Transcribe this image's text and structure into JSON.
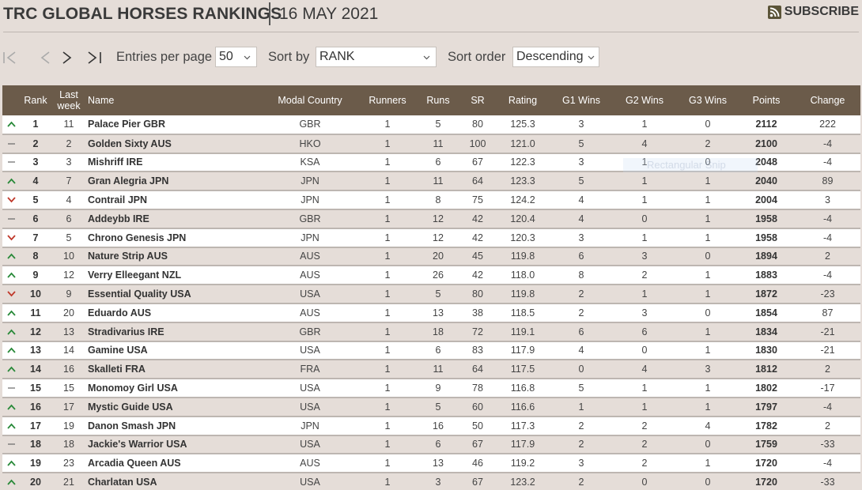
{
  "header": {
    "title": "TRC GLOBAL HORSES RANKINGS",
    "date": "16 MAY 2021",
    "subscribe_label": "SUBSCRIBE",
    "subscribe_icon": "rss-icon"
  },
  "controls": {
    "first_page_icon": "first-page-icon",
    "prev_page_icon": "prev-page-icon",
    "next_page_icon": "next-page-icon",
    "last_page_icon": "last-page-icon",
    "entries_label": "Entries per page",
    "entries_value": "50",
    "sort_by_label": "Sort by",
    "sort_by_value": "RANK",
    "sort_order_label": "Sort order",
    "sort_order_value": "Descending"
  },
  "overlay": {
    "tooltip": "Rectangular Snip"
  },
  "colors": {
    "header_bg": "#6b5b4a",
    "page_bg": "#e5ddd8",
    "up": "#2a8a3a",
    "down": "#c0392b"
  },
  "table": {
    "columns": [
      "",
      "Rank",
      "Last week",
      "Name",
      "Modal Country",
      "Runners",
      "Runs",
      "SR",
      "Rating",
      "G1 Wins",
      "G2 Wins",
      "G3 Wins",
      "Points",
      "Change"
    ],
    "rows": [
      {
        "trend": "up",
        "rank": "1",
        "last": "11",
        "name": "Palace Pier GBR",
        "country": "GBR",
        "runners": "1",
        "runs": "5",
        "sr": "80",
        "rating": "125.3",
        "g1": "3",
        "g2": "1",
        "g3": "0",
        "points": "2112",
        "change": "222"
      },
      {
        "trend": "same",
        "rank": "2",
        "last": "2",
        "name": "Golden Sixty AUS",
        "country": "HKO",
        "runners": "1",
        "runs": "11",
        "sr": "100",
        "rating": "121.0",
        "g1": "5",
        "g2": "4",
        "g3": "2",
        "points": "2100",
        "change": "-4"
      },
      {
        "trend": "same",
        "rank": "3",
        "last": "3",
        "name": "Mishriff IRE",
        "country": "KSA",
        "runners": "1",
        "runs": "6",
        "sr": "67",
        "rating": "122.3",
        "g1": "3",
        "g2": "1",
        "g3": "0",
        "points": "2048",
        "change": "-4"
      },
      {
        "trend": "up",
        "rank": "4",
        "last": "7",
        "name": "Gran Alegria JPN",
        "country": "JPN",
        "runners": "1",
        "runs": "11",
        "sr": "64",
        "rating": "123.3",
        "g1": "5",
        "g2": "1",
        "g3": "1",
        "points": "2040",
        "change": "89"
      },
      {
        "trend": "down",
        "rank": "5",
        "last": "4",
        "name": "Contrail JPN",
        "country": "JPN",
        "runners": "1",
        "runs": "8",
        "sr": "75",
        "rating": "124.2",
        "g1": "4",
        "g2": "1",
        "g3": "1",
        "points": "2004",
        "change": "3"
      },
      {
        "trend": "same",
        "rank": "6",
        "last": "6",
        "name": "Addeybb IRE",
        "country": "GBR",
        "runners": "1",
        "runs": "12",
        "sr": "42",
        "rating": "120.4",
        "g1": "4",
        "g2": "0",
        "g3": "1",
        "points": "1958",
        "change": "-4"
      },
      {
        "trend": "down",
        "rank": "7",
        "last": "5",
        "name": "Chrono Genesis JPN",
        "country": "JPN",
        "runners": "1",
        "runs": "12",
        "sr": "42",
        "rating": "120.3",
        "g1": "3",
        "g2": "1",
        "g3": "1",
        "points": "1958",
        "change": "-4"
      },
      {
        "trend": "up",
        "rank": "8",
        "last": "10",
        "name": "Nature Strip AUS",
        "country": "AUS",
        "runners": "1",
        "runs": "20",
        "sr": "45",
        "rating": "119.8",
        "g1": "6",
        "g2": "3",
        "g3": "0",
        "points": "1894",
        "change": "2"
      },
      {
        "trend": "up",
        "rank": "9",
        "last": "12",
        "name": "Verry Elleegant NZL",
        "country": "AUS",
        "runners": "1",
        "runs": "26",
        "sr": "42",
        "rating": "118.0",
        "g1": "8",
        "g2": "2",
        "g3": "1",
        "points": "1883",
        "change": "-4"
      },
      {
        "trend": "down",
        "rank": "10",
        "last": "9",
        "name": "Essential Quality USA",
        "country": "USA",
        "runners": "1",
        "runs": "5",
        "sr": "80",
        "rating": "119.8",
        "g1": "2",
        "g2": "1",
        "g3": "1",
        "points": "1872",
        "change": "-23"
      },
      {
        "trend": "up",
        "rank": "11",
        "last": "20",
        "name": "Eduardo AUS",
        "country": "AUS",
        "runners": "1",
        "runs": "13",
        "sr": "38",
        "rating": "118.5",
        "g1": "2",
        "g2": "3",
        "g3": "0",
        "points": "1854",
        "change": "87"
      },
      {
        "trend": "up",
        "rank": "12",
        "last": "13",
        "name": "Stradivarius IRE",
        "country": "GBR",
        "runners": "1",
        "runs": "18",
        "sr": "72",
        "rating": "119.1",
        "g1": "6",
        "g2": "6",
        "g3": "1",
        "points": "1834",
        "change": "-21"
      },
      {
        "trend": "up",
        "rank": "13",
        "last": "14",
        "name": "Gamine USA",
        "country": "USA",
        "runners": "1",
        "runs": "6",
        "sr": "83",
        "rating": "117.9",
        "g1": "4",
        "g2": "0",
        "g3": "1",
        "points": "1830",
        "change": "-21"
      },
      {
        "trend": "up",
        "rank": "14",
        "last": "16",
        "name": "Skalleti FRA",
        "country": "FRA",
        "runners": "1",
        "runs": "11",
        "sr": "64",
        "rating": "117.5",
        "g1": "0",
        "g2": "4",
        "g3": "3",
        "points": "1812",
        "change": "2"
      },
      {
        "trend": "same",
        "rank": "15",
        "last": "15",
        "name": "Monomoy Girl USA",
        "country": "USA",
        "runners": "1",
        "runs": "9",
        "sr": "78",
        "rating": "116.8",
        "g1": "5",
        "g2": "1",
        "g3": "1",
        "points": "1802",
        "change": "-17"
      },
      {
        "trend": "up",
        "rank": "16",
        "last": "17",
        "name": "Mystic Guide USA",
        "country": "USA",
        "runners": "1",
        "runs": "5",
        "sr": "60",
        "rating": "116.6",
        "g1": "1",
        "g2": "1",
        "g3": "1",
        "points": "1797",
        "change": "-4"
      },
      {
        "trend": "up",
        "rank": "17",
        "last": "19",
        "name": "Danon Smash JPN",
        "country": "JPN",
        "runners": "1",
        "runs": "16",
        "sr": "50",
        "rating": "117.3",
        "g1": "2",
        "g2": "2",
        "g3": "4",
        "points": "1782",
        "change": "2"
      },
      {
        "trend": "same",
        "rank": "18",
        "last": "18",
        "name": "Jackie's Warrior USA",
        "country": "USA",
        "runners": "1",
        "runs": "6",
        "sr": "67",
        "rating": "117.9",
        "g1": "2",
        "g2": "2",
        "g3": "0",
        "points": "1759",
        "change": "-33"
      },
      {
        "trend": "up",
        "rank": "19",
        "last": "23",
        "name": "Arcadia Queen AUS",
        "country": "AUS",
        "runners": "1",
        "runs": "13",
        "sr": "46",
        "rating": "119.2",
        "g1": "3",
        "g2": "2",
        "g3": "1",
        "points": "1720",
        "change": "-4"
      },
      {
        "trend": "up",
        "rank": "20",
        "last": "21",
        "name": "Charlatan USA",
        "country": "USA",
        "runners": "1",
        "runs": "3",
        "sr": "67",
        "rating": "123.2",
        "g1": "2",
        "g2": "0",
        "g3": "0",
        "points": "1720",
        "change": "-33"
      }
    ]
  }
}
